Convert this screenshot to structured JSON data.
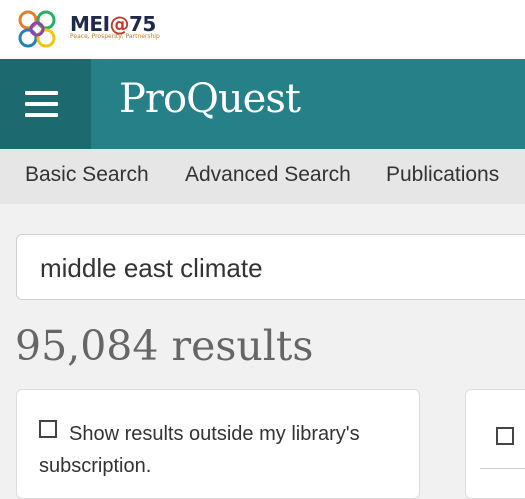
{
  "branding": {
    "logo_text_left": "MEI",
    "logo_text_at": "@",
    "logo_text_right": "75",
    "logo_tagline": "Peace, Prosperity, Partnership"
  },
  "header": {
    "brand": "ProQuest",
    "menu_icon": "hamburger-menu-icon",
    "colors": {
      "header_bg": "#258187",
      "menu_bg": "#1c6a6f"
    }
  },
  "nav": {
    "items": [
      {
        "label": "Basic Search"
      },
      {
        "label": "Advanced Search"
      },
      {
        "label": "Publications"
      }
    ]
  },
  "search": {
    "value": "middle east climate"
  },
  "results": {
    "count_text": "95,084 results"
  },
  "filters": {
    "outside_library_label": "Show results outside my library's subscription.",
    "outside_library_checked": false
  }
}
